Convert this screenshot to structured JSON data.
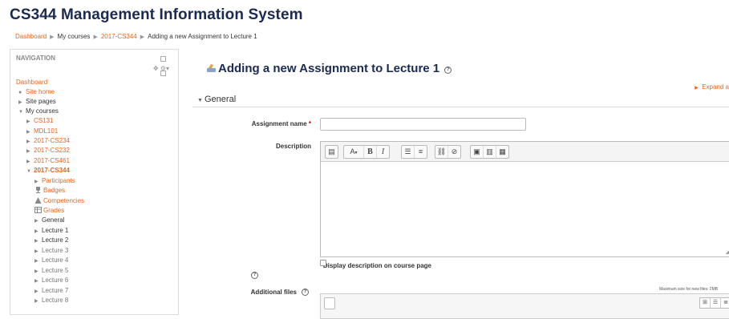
{
  "site": {
    "title": "CS344 Management Information System"
  },
  "breadcrumb": {
    "items": [
      "Dashboard",
      "My courses",
      "2017-CS344",
      "Adding a new Assignment to Lecture 1"
    ]
  },
  "navigation": {
    "header": "NAVIGATION",
    "items": [
      {
        "label": "Dashboard"
      },
      {
        "label": "Site home"
      },
      {
        "label": "Site pages"
      },
      {
        "label": "My courses"
      },
      {
        "label": "CS131"
      },
      {
        "label": "MDL101"
      },
      {
        "label": "2017-CS234"
      },
      {
        "label": "2017-CS232"
      },
      {
        "label": "2017-CS461"
      },
      {
        "label": "2017-CS344"
      },
      {
        "label": "Participants"
      },
      {
        "label": "Badges"
      },
      {
        "label": "Competencies"
      },
      {
        "label": "Grades"
      },
      {
        "label": "General"
      },
      {
        "label": "Lecture 1"
      },
      {
        "label": "Lecture 2"
      },
      {
        "label": "Lecture 3"
      },
      {
        "label": "Lecture 4"
      },
      {
        "label": "Lecture 5"
      },
      {
        "label": "Lecture 6"
      },
      {
        "label": "Lecture 7"
      },
      {
        "label": "Lecture 8"
      }
    ]
  },
  "main": {
    "title": "Adding a new Assignment to Lecture 1",
    "expand_all": "Expand a",
    "section": "General",
    "form": {
      "assignment_name_label": "Assignment name",
      "assignment_name_required": "*",
      "assignment_name_value": "",
      "description_label": "Description",
      "display_description_label": "Display description on course page",
      "additional_files_label": "Additional files",
      "max_size": "Maximum size for new files: 2MB"
    },
    "toolbar": {
      "paragraph": "A",
      "bold": "B",
      "italic": "I"
    }
  },
  "colors": {
    "link": "#e8661c",
    "title": "#1a2a50"
  }
}
